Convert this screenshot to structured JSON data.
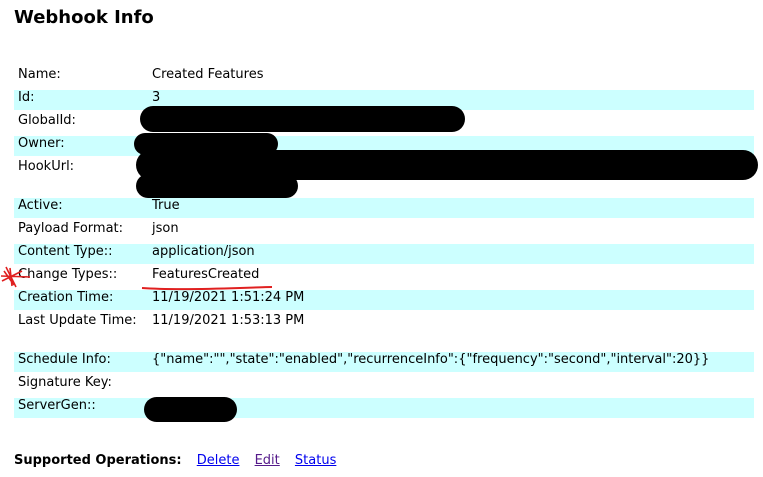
{
  "page": {
    "title": "Webhook Info"
  },
  "rows": [
    {
      "label": "Name:",
      "value": "Created Features"
    },
    {
      "label": "Id:",
      "value": "3"
    },
    {
      "label": "GlobalId:",
      "value": ""
    },
    {
      "label": "Owner:",
      "value": ""
    },
    {
      "label": "HookUrl:",
      "value": ""
    },
    {
      "label": "Active:",
      "value": "True"
    },
    {
      "label": "Payload Format:",
      "value": "json"
    },
    {
      "label": "Content Type::",
      "value": "application/json"
    },
    {
      "label": "Change Types::",
      "value": "FeaturesCreated"
    },
    {
      "label": "Creation Time:",
      "value": "11/19/2021 1:51:24 PM"
    },
    {
      "label": "Last Update Time:",
      "value": "11/19/2021 1:53:13 PM"
    },
    {
      "label": "Schedule Info:",
      "value": "{\"name\":\"\",\"state\":\"enabled\",\"recurrenceInfo\":{\"frequency\":\"second\",\"interval\":20}}"
    },
    {
      "label": "Signature Key:",
      "value": ""
    },
    {
      "label": "ServerGen::",
      "value": ""
    }
  ],
  "operations": {
    "label": "Supported Operations:",
    "links": [
      "Delete",
      "Edit",
      "Status"
    ]
  },
  "colors": {
    "row_shade": "#ccffff",
    "link": "#0000ee",
    "visited_link": "#551a8b",
    "annotation": "#e02020"
  }
}
